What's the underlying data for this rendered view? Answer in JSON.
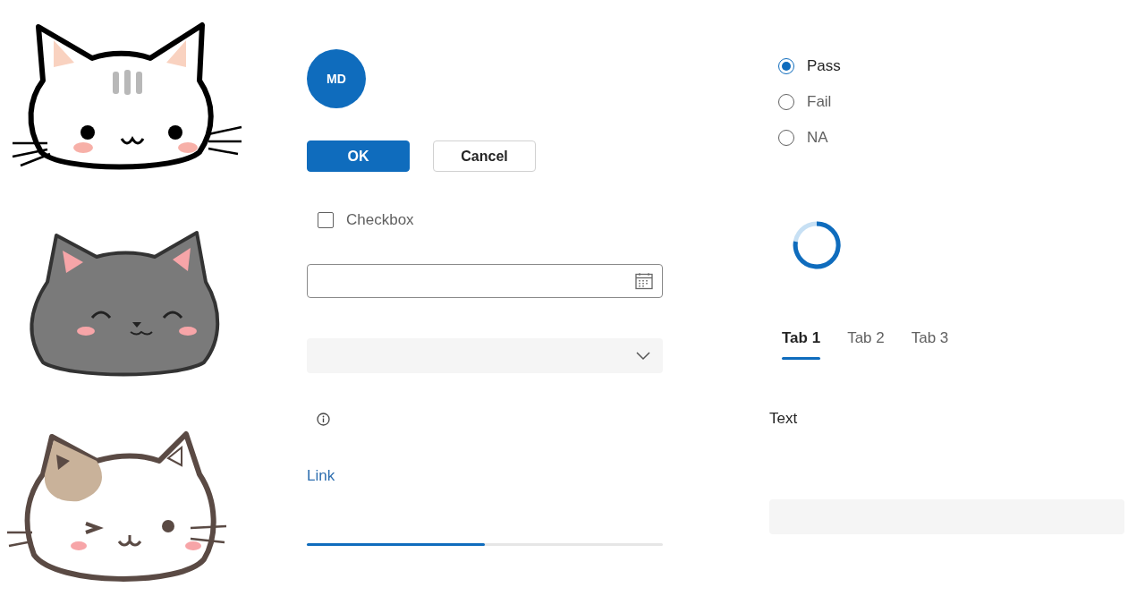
{
  "illustrations": [
    {
      "kind": "tabby-cat"
    },
    {
      "kind": "gray-cat"
    },
    {
      "kind": "calico-cat"
    }
  ],
  "avatar": {
    "initials": "MD"
  },
  "buttons": [
    {
      "label": "OK",
      "kind": "primary"
    },
    {
      "label": "Cancel",
      "kind": "secondary"
    }
  ],
  "checkbox": {
    "label": "Checkbox",
    "checked": false
  },
  "fields": [
    {
      "kind": "date"
    },
    {
      "kind": "dropdown"
    }
  ],
  "link": {
    "label": "Link"
  },
  "progress": {
    "level": 0.5
  },
  "radios": [
    {
      "label": "Pass",
      "selected": true
    },
    {
      "label": "Fail",
      "selected": false
    },
    {
      "label": "NA",
      "selected": false
    }
  ],
  "tabs": [
    {
      "label": "Tab 1",
      "selected": true
    },
    {
      "label": "Tab 2",
      "selected": false
    },
    {
      "label": "Tab 3",
      "selected": false
    }
  ],
  "text_label": "Text",
  "text_field": {
    "kind": "filled"
  }
}
